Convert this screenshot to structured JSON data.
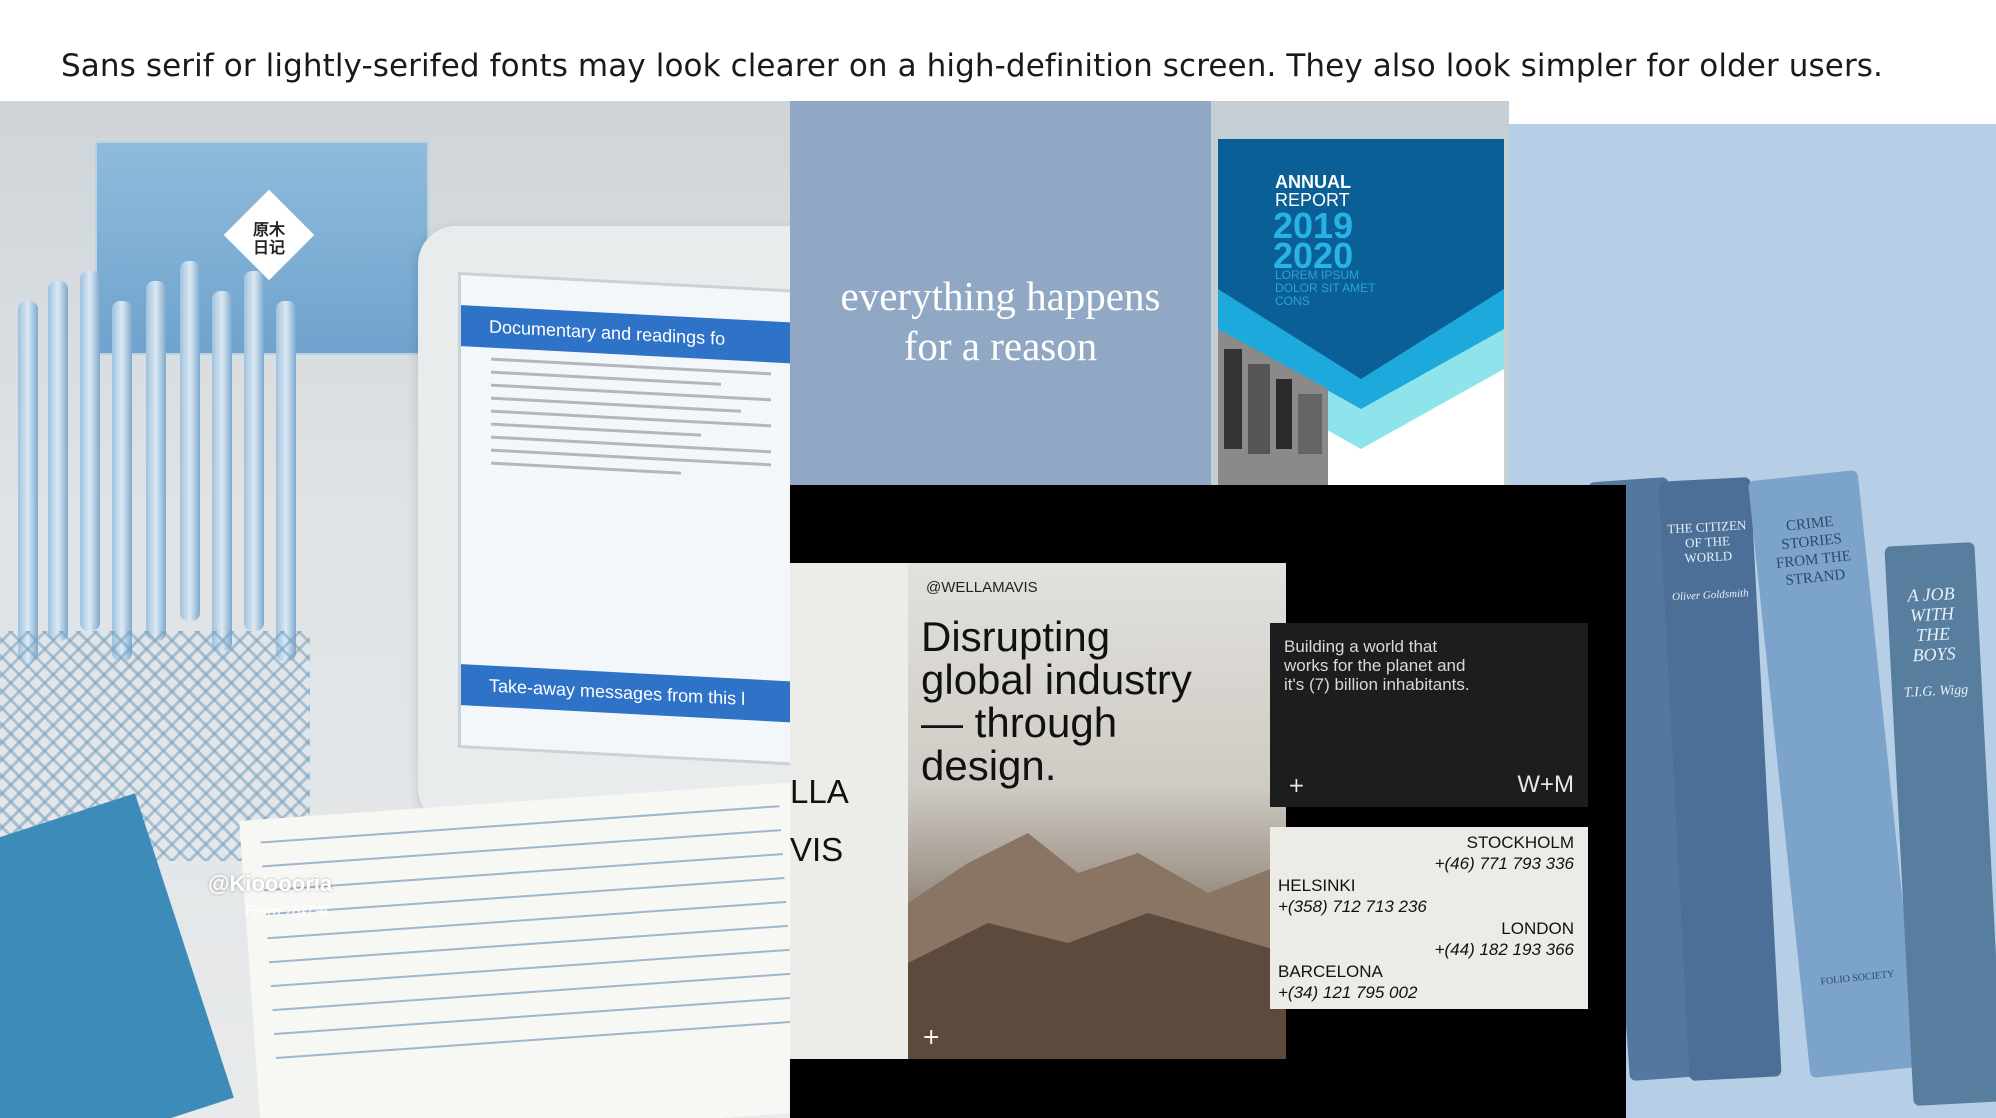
{
  "caption": "Sans serif or lightly-serifed fonts may look clearer on a high-definition screen. They also look simpler for older users.",
  "desk": {
    "tissue_label": "原木日记",
    "screen_header": "Documentary and readings fo",
    "screen_footer": "Take-away messages from this l",
    "watermark": "@Kiooooria",
    "watermark_sub": "From 小红书"
  },
  "quote": {
    "line1": "everything happens",
    "line2": "for a reason"
  },
  "report": {
    "title1": "ANNUAL",
    "title2": "REPORT",
    "year1": "2019",
    "year2": "2020",
    "small": "LOREM IPSUM DOLOR SIT AMET CONS"
  },
  "books": {
    "book1": "THE CITIZEN OF THE WORLD",
    "book1_author": "Oliver Goldsmith",
    "book2": "CRIME STORIES FROM THE STRAND",
    "book3": "A JOB WITH THE BOYS",
    "book3_author": "T.I.G. Wigg",
    "book2_foot": "FOLIO SOCIETY"
  },
  "wella": {
    "left_line1": "LLA",
    "left_line2": "VIS",
    "handle": "@WELLAMAVIS",
    "headline1": "Disrupting",
    "headline2": "global industry",
    "headline3": "— through",
    "headline4": "design.",
    "plus": "+",
    "dark_text": "Building a world that works for the planet and it's (7) billion inhabitants.",
    "logo": "W+M",
    "cities": [
      {
        "name": "STOCKHOLM",
        "phone": "+(46) 771 793 336"
      },
      {
        "name": "HELSINKI",
        "phone": "+(358) 712 713 236"
      },
      {
        "name": "LONDON",
        "phone": "+(44) 182 193 366"
      },
      {
        "name": "BARCELONA",
        "phone": "+(34) 121 795 002"
      }
    ]
  }
}
